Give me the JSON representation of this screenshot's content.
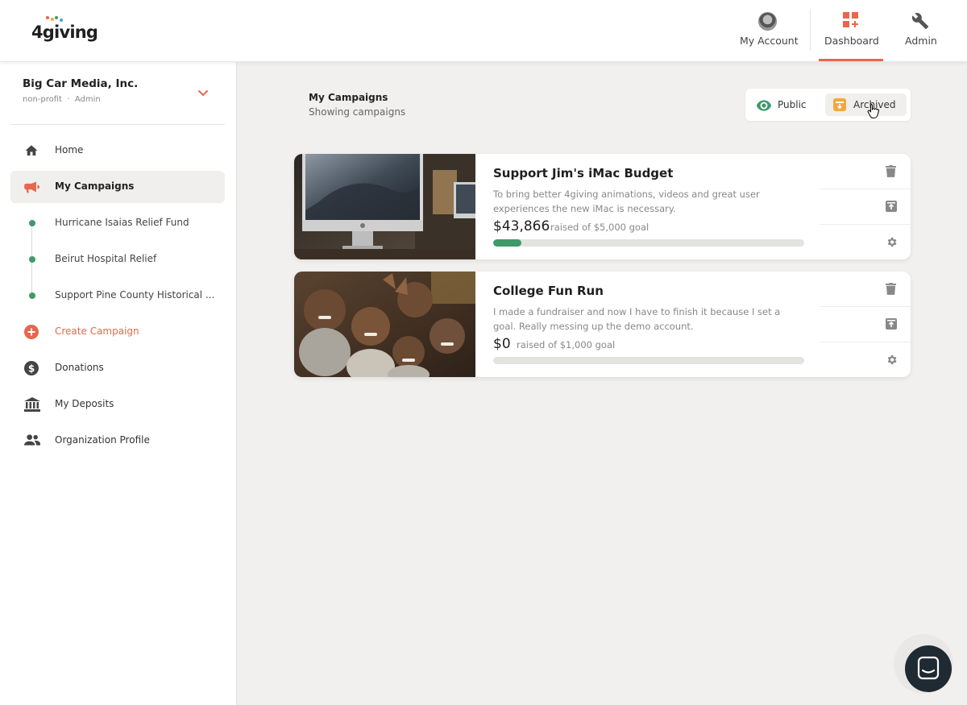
{
  "app": {
    "logo_text": "4giving",
    "brand_colors": {
      "accent": "#e8664d",
      "green": "#3f9a6a",
      "logo_dots": [
        "#e8664d",
        "#f2a93b",
        "#3f9a6a",
        "#4aa3c9"
      ]
    }
  },
  "header": {
    "nav": [
      {
        "label": "My Account",
        "icon": "avatar"
      },
      {
        "label": "Dashboard",
        "icon": "dashboard-icon",
        "active": true
      },
      {
        "label": "Admin",
        "icon": "wrench-icon"
      }
    ]
  },
  "sidebar": {
    "org_name": "Big Car Media, Inc.",
    "org_type": "non-profit",
    "org_role": "Admin",
    "items": [
      {
        "label": "Home",
        "icon": "home-icon"
      },
      {
        "label": "My Campaigns",
        "icon": "megaphone-icon",
        "active": true
      },
      {
        "label": "Hurricane Isaias Relief Fund",
        "icon": "dot"
      },
      {
        "label": "Beirut Hospital Relief",
        "icon": "dot"
      },
      {
        "label": "Support Pine County Historical ...",
        "icon": "dot"
      },
      {
        "label": "Create Campaign",
        "icon": "plus-circle-icon"
      },
      {
        "label": "Donations",
        "icon": "dollar-circle-icon"
      },
      {
        "label": "My Deposits",
        "icon": "bank-icon"
      },
      {
        "label": "Organization Profile",
        "icon": "people-icon"
      }
    ]
  },
  "main": {
    "title": "My Campaigns",
    "subtitle": "Showing campaigns",
    "filters": {
      "public": "Public",
      "archived": "Archived",
      "selected": "Archived"
    },
    "campaigns": [
      {
        "title": "Support Jim's iMac Budget",
        "description": "To bring better 4giving animations, videos and great user experiences the new iMac is necessary.",
        "amount": "$43,866",
        "goal_text": "raised of $5,000 goal",
        "progress": 0.09
      },
      {
        "title": "College Fun Run",
        "description": "I made a fundraiser and now I have to finish it because I set a goal. Really messing up the demo account.",
        "amount": "$0",
        "goal_text": "raised of $1,000 goal",
        "progress": 0
      }
    ]
  }
}
